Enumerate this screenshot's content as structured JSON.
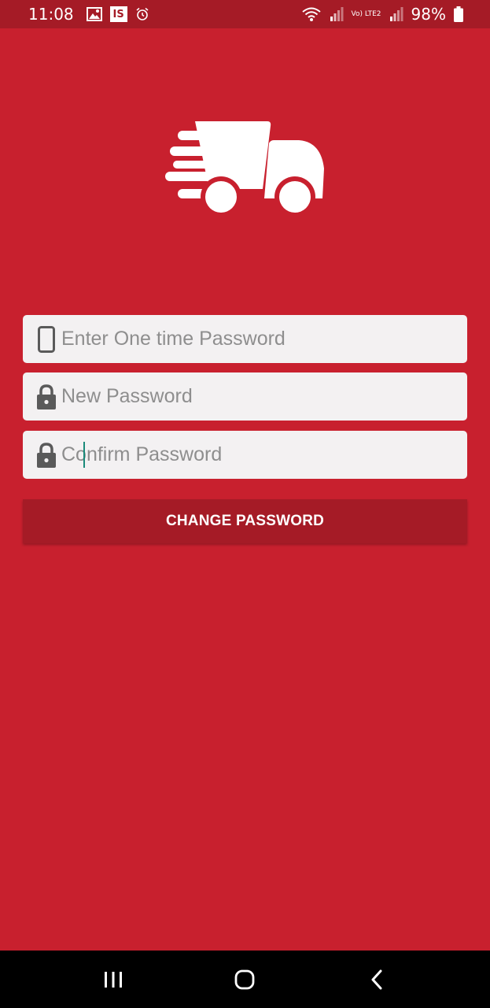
{
  "status_bar": {
    "time": "11:08",
    "carrier_badge": "IS",
    "network_label": "Vo) LTE2",
    "battery": "98%"
  },
  "logo": {
    "icon": "delivery-truck-icon"
  },
  "form": {
    "otp": {
      "placeholder": "Enter One time Password",
      "value": "",
      "icon": "phone-icon"
    },
    "new_password": {
      "placeholder": "New Password",
      "value": "",
      "icon": "lock-icon"
    },
    "confirm_password": {
      "placeholder": "Confirm Password",
      "value": "",
      "icon": "lock-icon"
    },
    "submit_label": "CHANGE PASSWORD"
  },
  "colors": {
    "background": "#c8202e",
    "status_bar": "#a51b26",
    "button": "#a51b26",
    "field": "#f3f1f2",
    "caret": "#1a8a7a"
  },
  "nav_bar": {
    "icons": [
      "recent-apps-icon",
      "home-icon",
      "back-icon"
    ]
  }
}
